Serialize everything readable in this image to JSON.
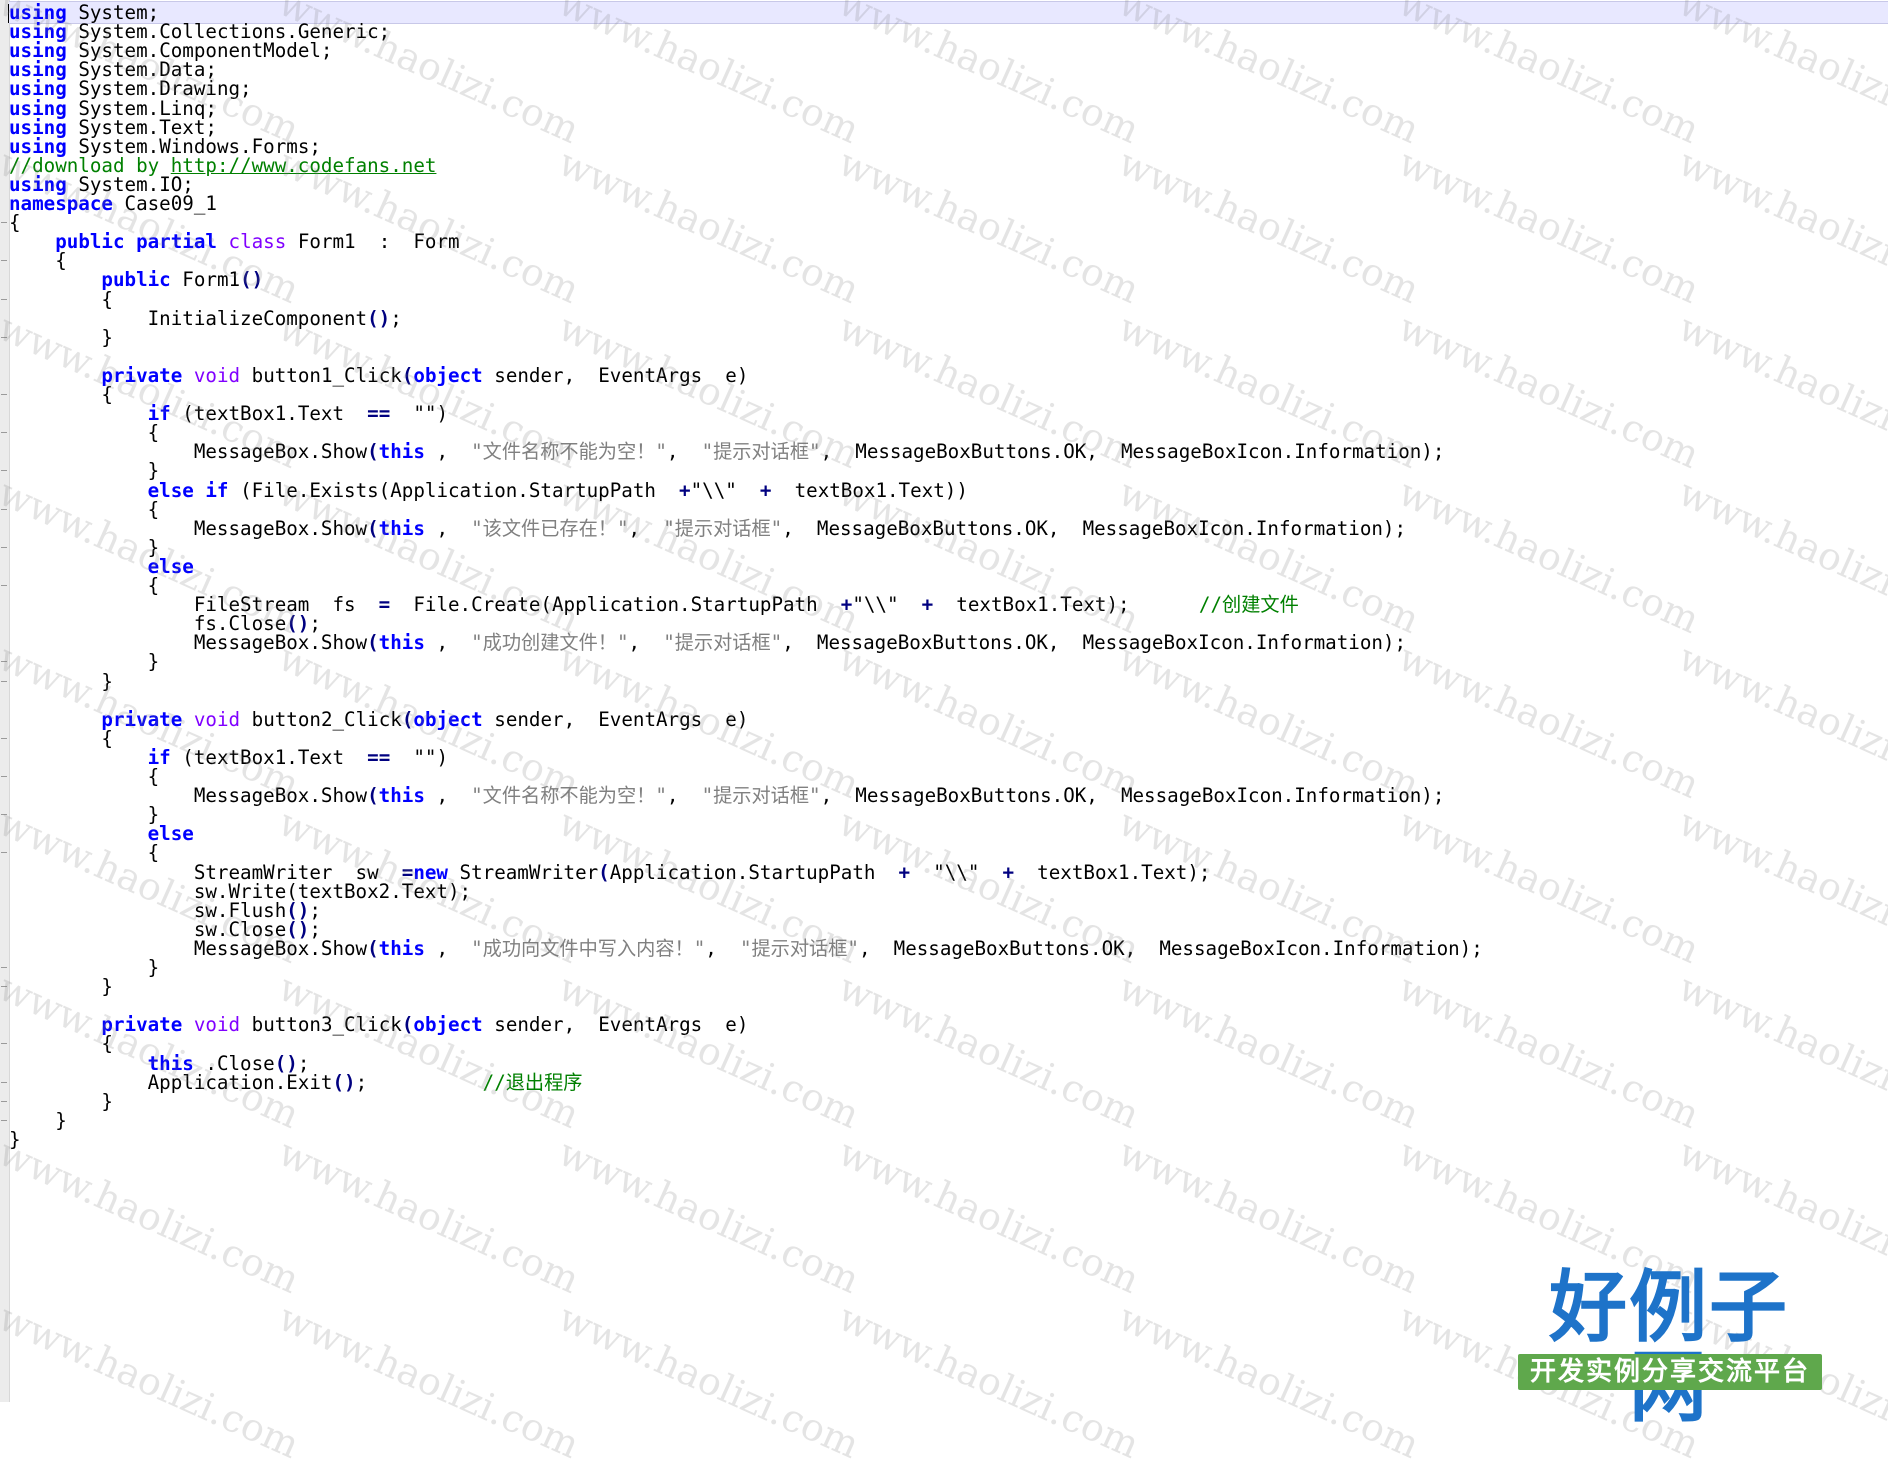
{
  "editor": {
    "lines": [
      [
        [
          "kw",
          "using"
        ],
        [
          "",
          "System;"
        ]
      ],
      [
        [
          "kw",
          "using"
        ],
        [
          "",
          "System.Collections.Generic;"
        ]
      ],
      [
        [
          "kw",
          "using"
        ],
        [
          "",
          "System.ComponentModel;"
        ]
      ],
      [
        [
          "kw",
          "using"
        ],
        [
          "",
          "System.Data;"
        ]
      ],
      [
        [
          "kw",
          "using"
        ],
        [
          "",
          "System.Drawing;"
        ]
      ],
      [
        [
          "kw",
          "using"
        ],
        [
          "",
          "System.Linq;"
        ]
      ],
      [
        [
          "kw",
          "using"
        ],
        [
          "",
          "System.Text;"
        ]
      ],
      [
        [
          "kw",
          "using"
        ],
        [
          "",
          "System.Windows.Forms;"
        ]
      ],
      [
        [
          "cm",
          "//download by "
        ],
        [
          "ln",
          "http://www.codefans.net"
        ]
      ],
      [
        [
          "kw",
          "using"
        ],
        [
          "",
          "System.IO;"
        ]
      ],
      [
        [
          "kw",
          "namespace"
        ],
        [
          "",
          "Case09_1"
        ]
      ],
      [
        [
          "",
          "{"
        ]
      ],
      [
        [
          "",
          "    "
        ],
        [
          "kw",
          "public partial"
        ],
        [
          "",
          ""
        ],
        [
          "ty",
          "class"
        ],
        [
          "",
          "Form1  :  Form"
        ]
      ],
      [
        [
          "",
          "    {"
        ]
      ],
      [
        [
          "",
          "        "
        ],
        [
          "kw",
          "public"
        ],
        [
          "",
          "Form1"
        ],
        [
          "op",
          "()"
        ]
      ],
      [
        [
          "",
          "        {"
        ]
      ],
      [
        [
          "",
          "            InitializeComponent"
        ],
        [
          "op",
          "()"
        ],
        [
          "",
          ";"
        ]
      ],
      [
        [
          "",
          "        }"
        ]
      ],
      [
        [
          "",
          "",
          ""
        ]
      ],
      [
        [
          "",
          "        "
        ],
        [
          "kw",
          "private"
        ],
        [
          "",
          ""
        ],
        [
          "ty",
          "void"
        ],
        [
          "",
          "button1_Click"
        ],
        [
          "op",
          "("
        ],
        [
          "kw",
          "object"
        ],
        [
          "",
          "sender,  EventArgs  e)"
        ]
      ],
      [
        [
          "",
          "        {"
        ]
      ],
      [
        [
          "",
          "            "
        ],
        [
          "kw",
          "if"
        ],
        [
          "",
          "(textBox1.Text  "
        ],
        [
          "op",
          "=="
        ],
        [
          "",
          "  \"\")"
        ]
      ],
      [
        [
          "",
          "            {"
        ]
      ],
      [
        [
          "",
          "                MessageBox.Show"
        ],
        [
          "op",
          "("
        ],
        [
          "kw",
          "this"
        ],
        [
          "",
          ",  "
        ],
        [
          "st",
          "\"文件名称不能为空！\""
        ],
        [
          "",
          ",  "
        ],
        [
          "st",
          "\"提示对话框\""
        ],
        [
          "",
          ",  MessageBoxButtons.OK,  MessageBoxIcon.Information);"
        ]
      ],
      [
        [
          "",
          "            }"
        ]
      ],
      [
        [
          "",
          "            "
        ],
        [
          "kw",
          "else if"
        ],
        [
          "",
          "(File.Exists(Application.StartupPath  "
        ],
        [
          "op",
          "+"
        ],
        [
          "",
          "\"\\\\\"  "
        ],
        [
          "op",
          "+"
        ],
        [
          "",
          "  textBox1.Text))"
        ]
      ],
      [
        [
          "",
          "            {"
        ]
      ],
      [
        [
          "",
          "                MessageBox.Show"
        ],
        [
          "op",
          "("
        ],
        [
          "kw",
          "this"
        ],
        [
          "",
          ",  "
        ],
        [
          "st",
          "\"该文件已存在！\""
        ],
        [
          "",
          ",  "
        ],
        [
          "st",
          "\"提示对话框\""
        ],
        [
          "",
          ",  MessageBoxButtons.OK,  MessageBoxIcon.Information);"
        ]
      ],
      [
        [
          "",
          "            }"
        ]
      ],
      [
        [
          "",
          "            "
        ],
        [
          "kw",
          "else"
        ]
      ],
      [
        [
          "",
          "            {"
        ]
      ],
      [
        [
          "",
          "                FileStream  fs  "
        ],
        [
          "op",
          "="
        ],
        [
          "",
          "  File.Create(Application.StartupPath  "
        ],
        [
          "op",
          "+"
        ],
        [
          "",
          "\"\\\\\"  "
        ],
        [
          "op",
          "+"
        ],
        [
          "",
          "  textBox1.Text);      "
        ],
        [
          "cm",
          "//创建文件"
        ]
      ],
      [
        [
          "",
          "                fs.Close"
        ],
        [
          "op",
          "()"
        ],
        [
          "",
          ";"
        ]
      ],
      [
        [
          "",
          "                MessageBox.Show"
        ],
        [
          "op",
          "("
        ],
        [
          "kw",
          "this"
        ],
        [
          "",
          ",  "
        ],
        [
          "st",
          "\"成功创建文件！\""
        ],
        [
          "",
          ",  "
        ],
        [
          "st",
          "\"提示对话框\""
        ],
        [
          "",
          ",  MessageBoxButtons.OK,  MessageBoxIcon.Information);"
        ]
      ],
      [
        [
          "",
          "            }"
        ]
      ],
      [
        [
          "",
          "        }"
        ]
      ],
      [
        [
          "",
          ""
        ]
      ],
      [
        [
          "",
          "        "
        ],
        [
          "kw",
          "private"
        ],
        [
          "",
          ""
        ],
        [
          "ty",
          "void"
        ],
        [
          "",
          "button2_Click"
        ],
        [
          "op",
          "("
        ],
        [
          "kw",
          "object"
        ],
        [
          "",
          "sender,  EventArgs  e)"
        ]
      ],
      [
        [
          "",
          "        {"
        ]
      ],
      [
        [
          "",
          "            "
        ],
        [
          "kw",
          "if"
        ],
        [
          "",
          "(textBox1.Text  "
        ],
        [
          "op",
          "=="
        ],
        [
          "",
          "  \"\")"
        ]
      ],
      [
        [
          "",
          "            {"
        ]
      ],
      [
        [
          "",
          "                MessageBox.Show"
        ],
        [
          "op",
          "("
        ],
        [
          "kw",
          "this"
        ],
        [
          "",
          ",  "
        ],
        [
          "st",
          "\"文件名称不能为空！\""
        ],
        [
          "",
          ",  "
        ],
        [
          "st",
          "\"提示对话框\""
        ],
        [
          "",
          ",  MessageBoxButtons.OK,  MessageBoxIcon.Information);"
        ]
      ],
      [
        [
          "",
          "            }"
        ]
      ],
      [
        [
          "",
          "            "
        ],
        [
          "kw",
          "else"
        ]
      ],
      [
        [
          "",
          "            {"
        ]
      ],
      [
        [
          "",
          "                StreamWriter  sw  "
        ],
        [
          "op",
          "="
        ],
        [
          "",
          ""
        ],
        [
          "kw",
          "new"
        ],
        [
          "",
          "StreamWriter"
        ],
        [
          "op",
          "("
        ],
        [
          "",
          "Application.StartupPath  "
        ],
        [
          "op",
          "+"
        ],
        [
          "",
          "  \"\\\\\"  "
        ],
        [
          "op",
          "+"
        ],
        [
          "",
          "  textBox1.Text);"
        ]
      ],
      [
        [
          "",
          "                sw.Write(textBox2.Text);"
        ]
      ],
      [
        [
          "",
          "                sw.Flush"
        ],
        [
          "op",
          "()"
        ],
        [
          "",
          ";"
        ]
      ],
      [
        [
          "",
          "                sw.Close"
        ],
        [
          "op",
          "()"
        ],
        [
          "",
          ";"
        ]
      ],
      [
        [
          "",
          "                MessageBox.Show"
        ],
        [
          "op",
          "("
        ],
        [
          "kw",
          "this"
        ],
        [
          "",
          ",  "
        ],
        [
          "st",
          "\"成功向文件中写入内容！\""
        ],
        [
          "",
          ",  "
        ],
        [
          "st",
          "\"提示对话框\""
        ],
        [
          "",
          ",  MessageBoxButtons.OK,  MessageBoxIcon.Information);"
        ]
      ],
      [
        [
          "",
          "            }"
        ]
      ],
      [
        [
          "",
          "        }"
        ]
      ],
      [
        [
          "",
          ""
        ]
      ],
      [
        [
          "",
          "        "
        ],
        [
          "kw",
          "private"
        ],
        [
          "",
          ""
        ],
        [
          "ty",
          "void"
        ],
        [
          "",
          "button3_Click"
        ],
        [
          "op",
          "("
        ],
        [
          "kw",
          "object"
        ],
        [
          "",
          "sender,  EventArgs  e)"
        ]
      ],
      [
        [
          "",
          "        {"
        ]
      ],
      [
        [
          "",
          "            "
        ],
        [
          "kw",
          "this"
        ],
        [
          "",
          ".Close"
        ],
        [
          "op",
          "()"
        ],
        [
          "",
          ";"
        ]
      ],
      [
        [
          "",
          "            Application.Exit"
        ],
        [
          "op",
          "()"
        ],
        [
          "",
          ";          "
        ],
        [
          "cm",
          "//退出程序"
        ]
      ],
      [
        [
          "",
          "        }"
        ]
      ],
      [
        [
          "",
          "    }"
        ]
      ],
      [
        [
          "",
          "}"
        ]
      ]
    ]
  },
  "watermark": {
    "text": "www.haolizi.com"
  },
  "logo": {
    "title": "好例子网",
    "subtitle": "开发实例分享交流平台"
  }
}
